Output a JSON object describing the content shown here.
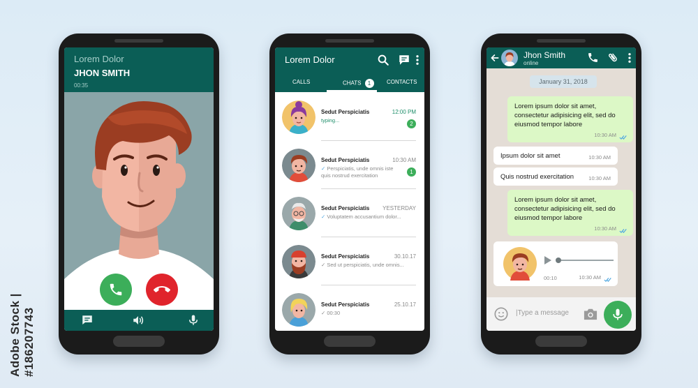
{
  "watermark": "Adobe Stock | #186207743",
  "colors": {
    "header": "#0b5e56",
    "accept": "#3cae5a",
    "decline": "#e0242c",
    "outgoing": "#dcf8c6",
    "badge": "#3cae5a"
  },
  "call_screen": {
    "app_name": "Lorem Dolor",
    "caller_name": "JHON SMITH",
    "duration": "00:35",
    "accept_icon": "phone-accept-icon",
    "decline_icon": "phone-decline-icon",
    "bottom_icons": [
      "message-icon",
      "speaker-icon",
      "mic-icon"
    ]
  },
  "chats_screen": {
    "title": "Lorem Dolor",
    "header_icons": [
      "search-icon",
      "chat-icon",
      "more-icon"
    ],
    "tabs": [
      {
        "label": "CALLS"
      },
      {
        "label": "CHATS",
        "badge": "1",
        "active": true
      },
      {
        "label": "CONTACTS"
      }
    ],
    "chats": [
      {
        "name": "Sedut Perspiciatis",
        "time": "12:00 PM",
        "preview": "typing...",
        "badge": "2",
        "status": "typing"
      },
      {
        "name": "Sedut Perspiciatis",
        "time": "10:30 AM",
        "preview": "Perspiciatis, unde omnis iste quis nostrud exercitation",
        "badge": "1",
        "status": "read"
      },
      {
        "name": "Sedut Perspiciatis",
        "time": "YESTERDAY",
        "preview": "Voluptatem accusantium dolor...",
        "badge": "",
        "status": "read"
      },
      {
        "name": "Sedut Perspiciatis",
        "time": "30.10.17",
        "preview": "Sed ut perspiciatis, unde omnis...",
        "badge": "",
        "status": "delivered"
      },
      {
        "name": "Sedut Perspiciatis",
        "time": "25.10.17",
        "preview": "00:30",
        "badge": "",
        "status": "delivered"
      }
    ]
  },
  "conversation_screen": {
    "contact_name": "Jhon Smith",
    "contact_status": "online",
    "header_icons": [
      "back-arrow-icon",
      "phone-icon",
      "attachment-icon",
      "more-icon"
    ],
    "date": "January 31, 2018",
    "messages": [
      {
        "direction": "out",
        "text": "Lorem ipsum dolor sit amet, consectetur adipisicing elit, sed do eiusmod tempor labore",
        "time": "10:30 AM"
      },
      {
        "direction": "in",
        "text": "Ipsum dolor sit amet",
        "time": "10:30 AM"
      },
      {
        "direction": "in",
        "text": "Quis nostrud exercitation",
        "time": "10:30 AM"
      },
      {
        "direction": "out",
        "text": "Lorem ipsum dolor sit amet, consectetur adipisicing elit, sed do eiusmod tempor labore",
        "time": "10:30 AM"
      },
      {
        "direction": "in",
        "type": "voice",
        "duration": "00:10",
        "time": "10:30 AM"
      }
    ],
    "input_placeholder": "|Type a message",
    "input_icons": [
      "emoji-icon",
      "camera-icon",
      "mic-icon"
    ]
  }
}
